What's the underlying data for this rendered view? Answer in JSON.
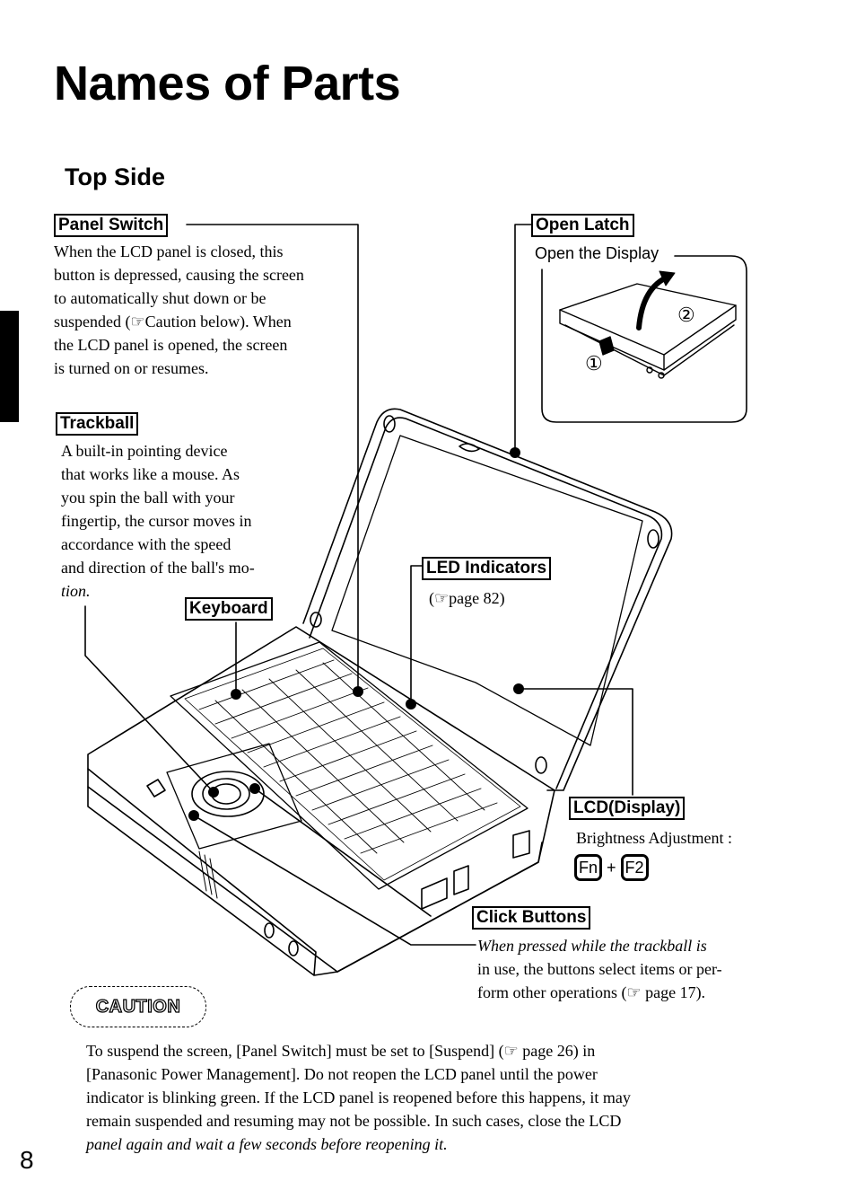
{
  "page": {
    "title": "Names of Parts",
    "section_title": "Top Side",
    "page_number": "8"
  },
  "parts": {
    "panel_switch": {
      "label": "Panel Switch",
      "description_lines": [
        "When the LCD panel is closed, this",
        "button is depressed, causing the screen",
        "to automatically shut down or be",
        "suspended (☞Caution below). When",
        "the LCD panel is opened, the screen",
        "is turned on or resumes."
      ]
    },
    "trackball": {
      "label": "Trackball",
      "description_lines": [
        "A built-in pointing device",
        "that works like a mouse. As",
        "you spin the ball with your",
        "fingertip, the cursor moves in",
        "accordance with the speed",
        "and direction of the ball's mo-",
        "tion."
      ]
    },
    "keyboard": {
      "label": "Keyboard"
    },
    "open_latch": {
      "label": "Open Latch",
      "inset_caption": "Open the Display",
      "step_1": "①",
      "step_2": "②"
    },
    "led_indicators": {
      "label": "LED Indicators",
      "reference": "(☞page 82)"
    },
    "lcd_display": {
      "label": "LCD(Display)",
      "note": "Brightness Adjustment :",
      "shortcut_keys": [
        "Fn",
        "F2"
      ],
      "shortcut_joiner": "+"
    },
    "click_buttons": {
      "label": "Click Buttons",
      "description_lines": [
        "When pressed while the trackball is",
        "in use, the buttons select items or per-",
        "form other operations (☞ page 17)."
      ]
    }
  },
  "caution": {
    "badge": "CAUTION",
    "body_lines": [
      "To suspend the screen, [Panel Switch] must be set to [Suspend] (☞ page 26) in",
      "[Panasonic Power Management]. Do not reopen the LCD panel until the power",
      "indicator is blinking green. If the LCD panel is reopened before this happens, it may",
      "remain suspended and resuming may not be possible. In such cases, close the LCD",
      "panel again and wait a few seconds before reopening it."
    ]
  }
}
